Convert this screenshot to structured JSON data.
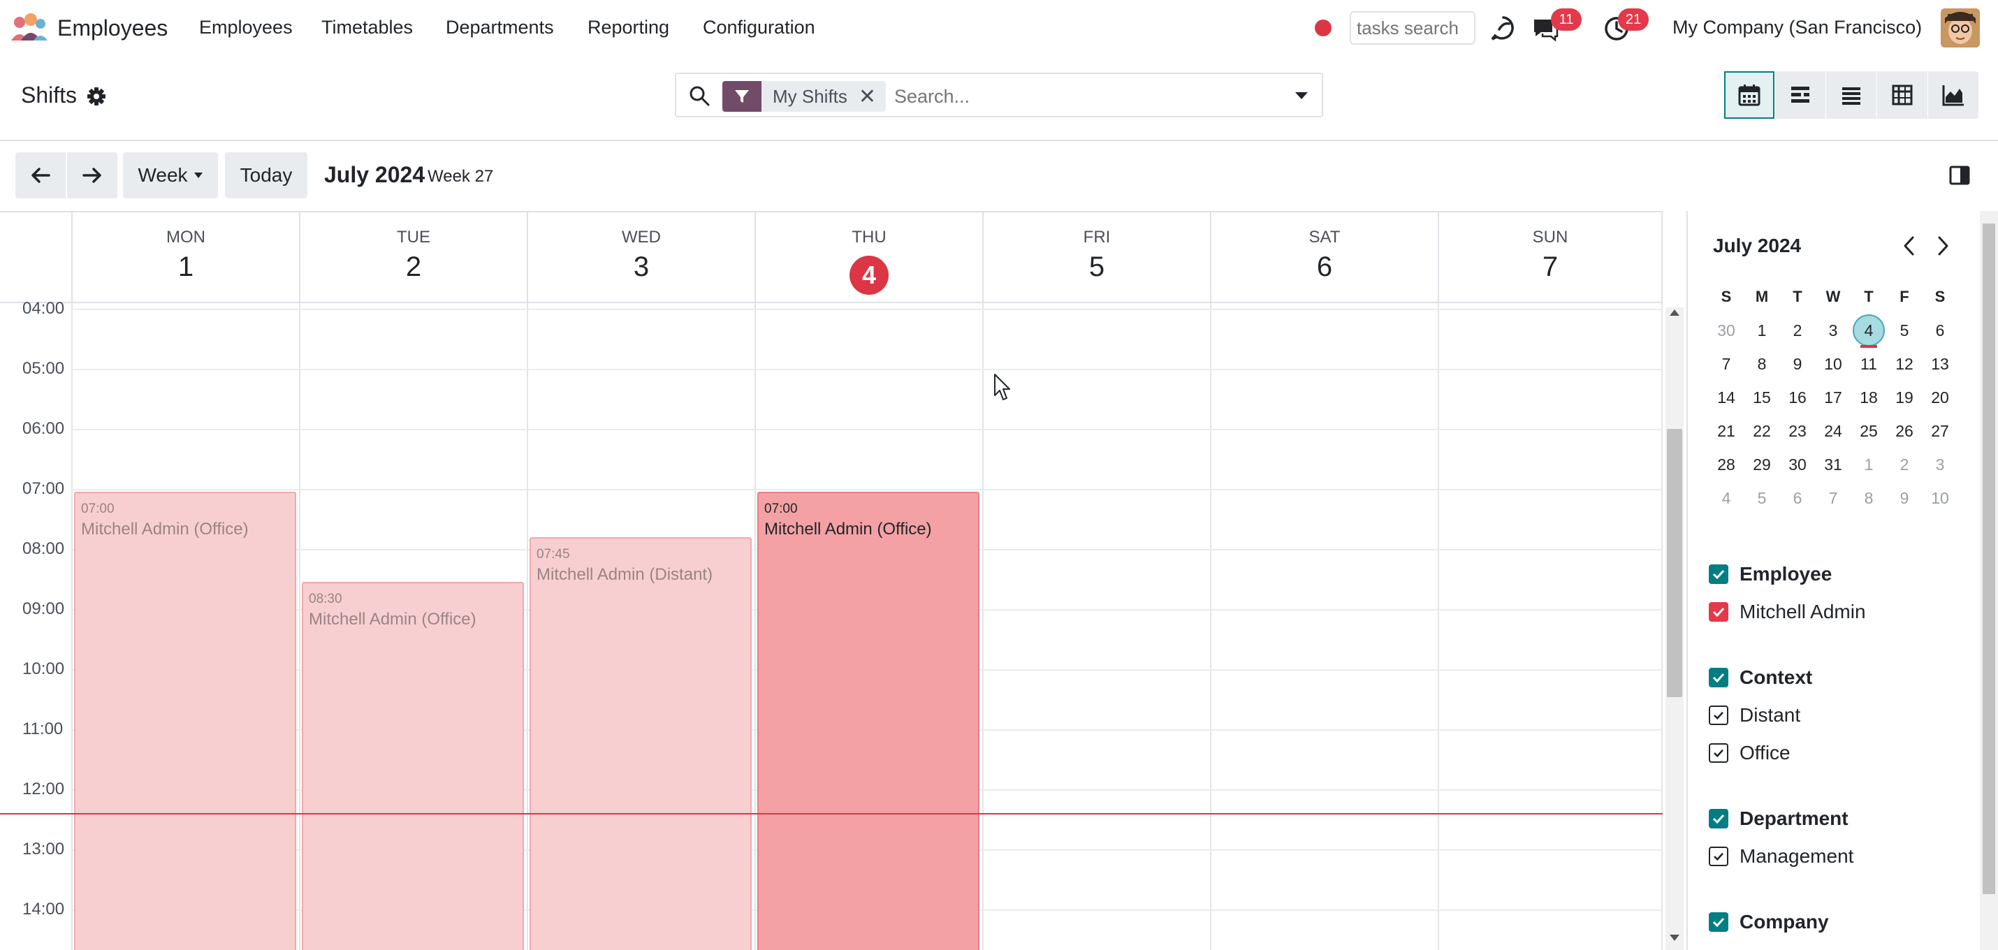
{
  "navbar": {
    "app_name": "Employees",
    "menu": [
      "Employees",
      "Timetables",
      "Departments",
      "Reporting",
      "Configuration"
    ],
    "tasks_search_placeholder": "tasks search",
    "messages_badge": "11",
    "activities_badge": "21",
    "company": "My Company (San Francisco)",
    "colors": {
      "brand": "#714b67",
      "recording": "#dc3545",
      "badge": "#e4384b"
    }
  },
  "control_panel": {
    "title": "Shifts",
    "facet_label": "My Shifts",
    "search_placeholder": "Search...",
    "views": [
      "calendar",
      "gantt",
      "list",
      "pivot",
      "graph"
    ],
    "active_view": "calendar"
  },
  "toolbar": {
    "scale": "Week",
    "today": "Today",
    "range_title": "July 2024",
    "week_label": "Week 27"
  },
  "calendar": {
    "days": [
      {
        "name": "MON",
        "num": "1"
      },
      {
        "name": "TUE",
        "num": "2"
      },
      {
        "name": "WED",
        "num": "3"
      },
      {
        "name": "THU",
        "num": "4",
        "today": true
      },
      {
        "name": "FRI",
        "num": "5"
      },
      {
        "name": "SAT",
        "num": "6"
      },
      {
        "name": "SUN",
        "num": "7"
      }
    ],
    "hours": [
      "04:00",
      "05:00",
      "06:00",
      "07:00",
      "08:00",
      "09:00",
      "10:00",
      "11:00",
      "12:00",
      "13:00",
      "14:00"
    ],
    "events": [
      {
        "day": "MON",
        "time": "07:00",
        "title": "Mitchell Admin (Office)"
      },
      {
        "day": "TUE",
        "time": "08:30",
        "title": "Mitchell Admin (Office)"
      },
      {
        "day": "WED",
        "time": "07:45",
        "title": "Mitchell Admin (Distant)"
      },
      {
        "day": "THU",
        "time": "07:00",
        "title": "Mitchell Admin (Office)",
        "active": true
      }
    ],
    "colors": {
      "today": "#dc3545",
      "event": "#f8cfd1",
      "event_active": "#f3a1a4"
    }
  },
  "side_panel": {
    "mini_title": "July 2024",
    "dow": [
      "S",
      "M",
      "T",
      "W",
      "T",
      "F",
      "S"
    ],
    "weeks": [
      [
        "30",
        "1",
        "2",
        "3",
        "4",
        "5",
        "6"
      ],
      [
        "7",
        "8",
        "9",
        "10",
        "11",
        "12",
        "13"
      ],
      [
        "14",
        "15",
        "16",
        "17",
        "18",
        "19",
        "20"
      ],
      [
        "21",
        "22",
        "23",
        "24",
        "25",
        "26",
        "27"
      ],
      [
        "28",
        "29",
        "30",
        "31",
        "1",
        "2",
        "3"
      ],
      [
        "4",
        "5",
        "6",
        "7",
        "8",
        "9",
        "10"
      ]
    ],
    "filters": {
      "employee": {
        "head": "Employee",
        "items": [
          "Mitchell Admin"
        ]
      },
      "context": {
        "head": "Context",
        "items": [
          "Distant",
          "Office"
        ]
      },
      "department": {
        "head": "Department",
        "items": [
          "Management"
        ]
      },
      "company": {
        "head": "Company"
      }
    }
  }
}
